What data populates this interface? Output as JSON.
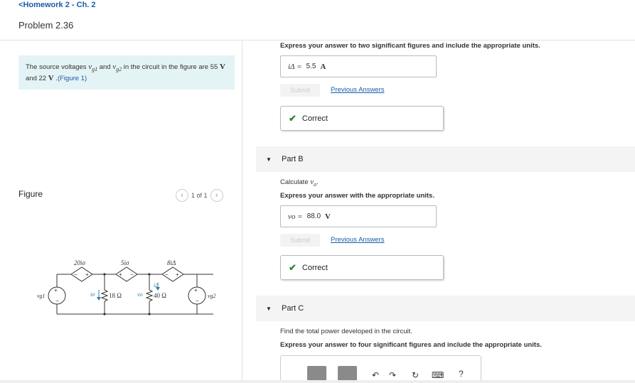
{
  "nav": {
    "back_label": "Homework 2 - Ch. 2"
  },
  "problem": {
    "title": "Problem 2.36"
  },
  "statement": {
    "p1": "The source voltages ",
    "vg1": "vg1",
    "and": " and ",
    "vg2": "vg2",
    "p2": " in the circuit in the figure are 55 ",
    "v1": "V",
    "p3": " and 22 ",
    "v2": "V",
    "p4": " .",
    "figure_link": "(Figure 1)"
  },
  "figure": {
    "label": "Figure",
    "pager": "1 of 1"
  },
  "circuit": {
    "dep_sources": [
      "20iσ",
      "5iσ",
      "8iΔ"
    ],
    "resistors": [
      "18 Ω",
      "40 Ω"
    ],
    "labels": {
      "vg1": "vg1",
      "vg2": "vg2",
      "i_sigma": "iσ",
      "v_o": "vo",
      "i_delta": "iΔ"
    }
  },
  "partA": {
    "instruction": "Express your answer to two significant figures and include the appropriate units.",
    "answer_label": "iΔ =",
    "answer_value": "5.5",
    "answer_unit": "A",
    "submit": "Submit",
    "previous": "Previous Answers",
    "result": "Correct"
  },
  "partB": {
    "header": "Part B",
    "prompt": "Calculate vo.",
    "instruction": "Express your answer with the appropriate units.",
    "answer_label": "vo =",
    "answer_value": "88.0",
    "answer_unit": "V",
    "submit": "Submit",
    "previous": "Previous Answers",
    "result": "Correct"
  },
  "partC": {
    "header": "Part C",
    "prompt": "Find the total power developed in the circuit.",
    "instruction": "Express your answer to four significant figures and include the appropriate units."
  },
  "toolbar": {
    "help": "?"
  }
}
